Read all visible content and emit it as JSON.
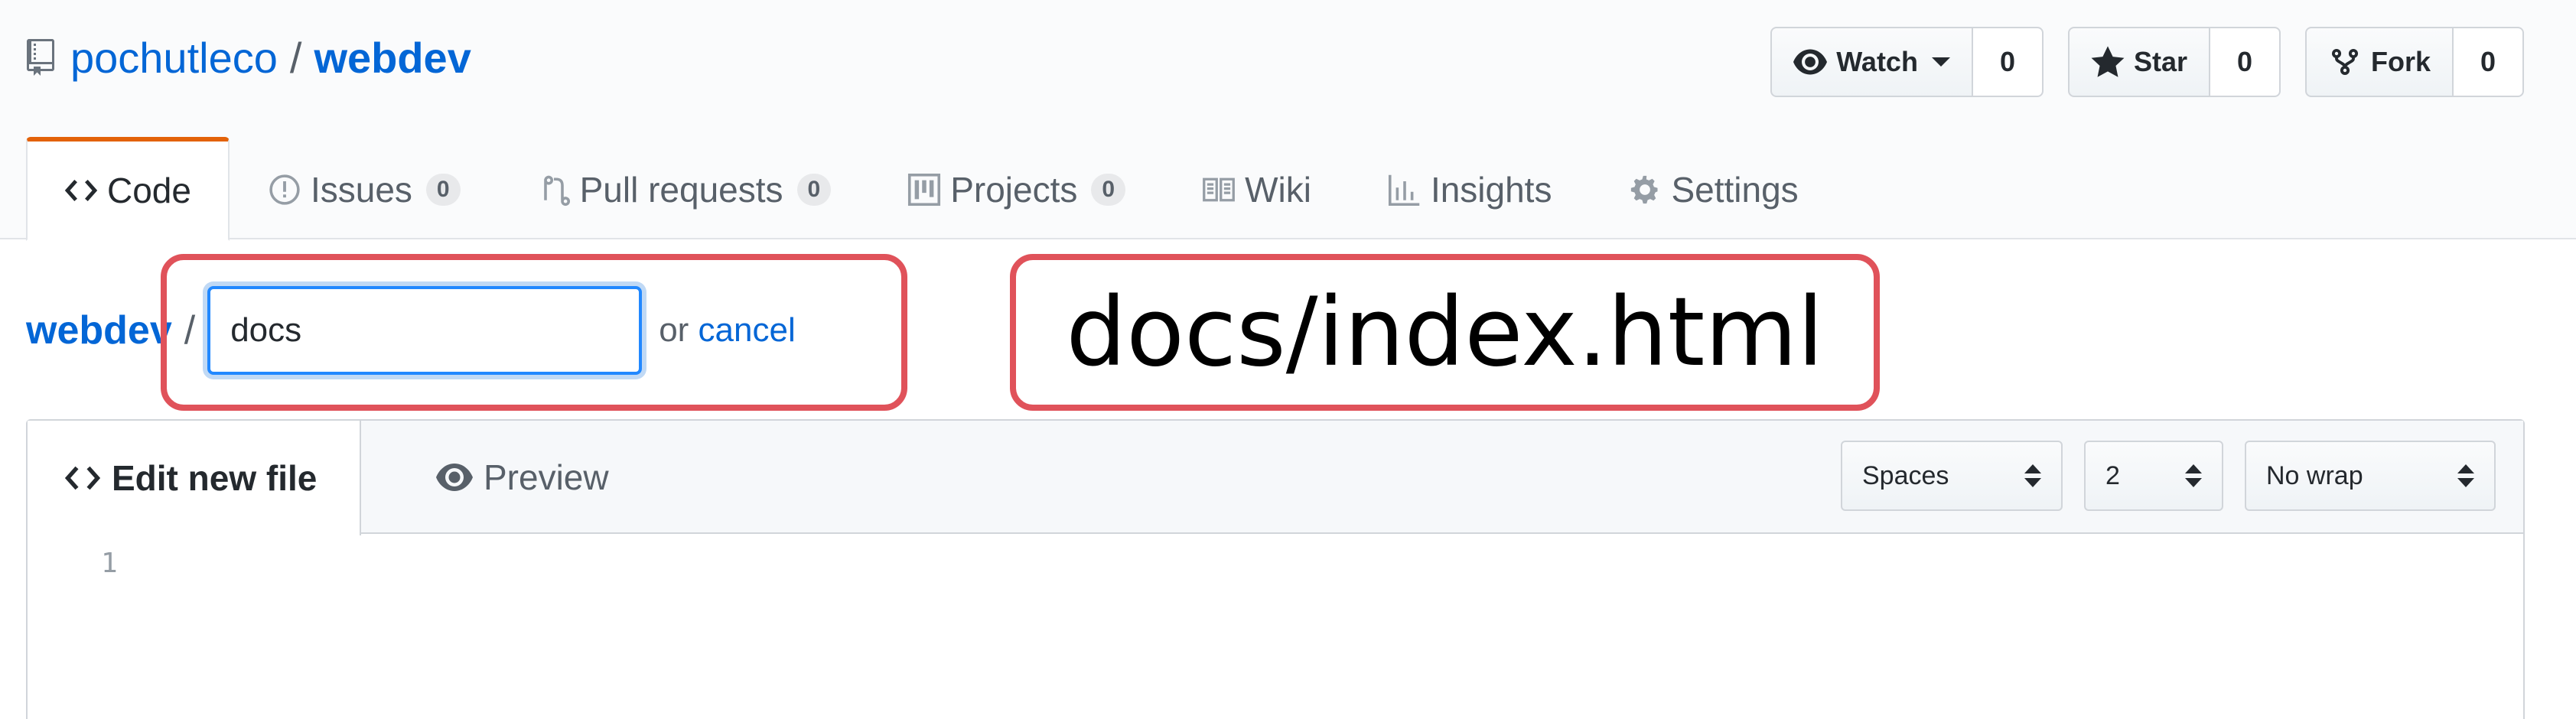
{
  "repo": {
    "owner": "pochutleco",
    "separator": "/",
    "name": "webdev"
  },
  "actions": [
    {
      "label": "Watch",
      "count": "0",
      "icon": "eye-icon"
    },
    {
      "label": "Star",
      "count": "0",
      "icon": "star-icon"
    },
    {
      "label": "Fork",
      "count": "0",
      "icon": "fork-icon"
    }
  ],
  "tabs": [
    {
      "label": "Code",
      "icon": "code-icon"
    },
    {
      "label": "Issues",
      "count": "0",
      "icon": "issue-icon"
    },
    {
      "label": "Pull requests",
      "count": "0",
      "icon": "pull-request-icon"
    },
    {
      "label": "Projects",
      "count": "0",
      "icon": "project-icon"
    },
    {
      "label": "Wiki",
      "icon": "book-icon"
    },
    {
      "label": "Insights",
      "icon": "graph-icon"
    },
    {
      "label": "Settings",
      "icon": "gear-icon"
    }
  ],
  "path": {
    "root": "webdev",
    "slash": "/",
    "filename_value": "docs",
    "or_text": "or",
    "cancel_label": "cancel"
  },
  "annotation": {
    "text": "docs/index.html",
    "color": "#e0525a"
  },
  "editor": {
    "tab_edit": "Edit new file",
    "tab_preview": "Preview",
    "indent_mode": "Spaces",
    "indent_size": "2",
    "wrap_mode": "No wrap",
    "line_numbers": [
      "1"
    ]
  },
  "colors": {
    "accent": "#0366d6",
    "tab_underline": "#e36209"
  }
}
